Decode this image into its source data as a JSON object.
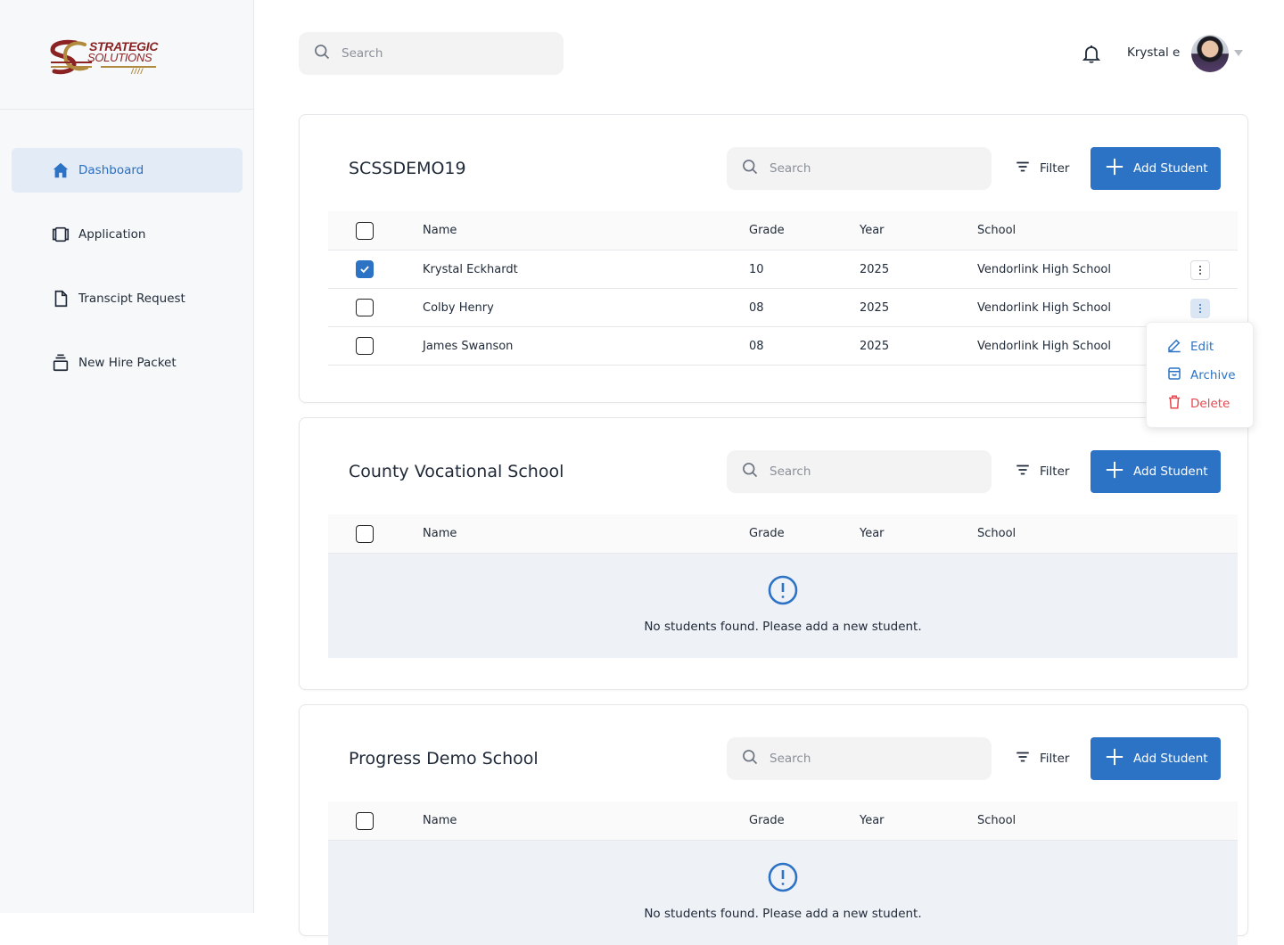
{
  "brand": {
    "line1": "STRATEGIC",
    "line2": "SOLUTIONS"
  },
  "sidebar": {
    "items": [
      {
        "label": "Dashboard",
        "icon": "home-icon",
        "active": true
      },
      {
        "label": "Application",
        "icon": "application-icon"
      },
      {
        "label": "Transcipt Request",
        "icon": "document-icon"
      },
      {
        "label": "New Hire Packet",
        "icon": "packet-icon"
      }
    ]
  },
  "header": {
    "search_placeholder": "Search",
    "user_name": "Krystal e"
  },
  "colors": {
    "accent": "#2d73c5",
    "danger": "#e5484d",
    "brand": "#8b2323"
  },
  "columns": {
    "name": "Name",
    "grade": "Grade",
    "year": "Year",
    "school": "School"
  },
  "cards": [
    {
      "title": "SCSSDEMO19",
      "search_placeholder": "Search",
      "filter_label": "Filter",
      "add_label": "Add Student",
      "rows": [
        {
          "name": "Krystal Eckhardt",
          "grade": "10",
          "year": "2025",
          "school": "Vendorlink High School",
          "checked": true
        },
        {
          "name": "Colby Henry",
          "grade": "08",
          "year": "2025",
          "school": "Vendorlink High School",
          "checked": false
        },
        {
          "name": "James Swanson",
          "grade": "08",
          "year": "2025",
          "school": "Vendorlink High School",
          "checked": false
        }
      ]
    },
    {
      "title": "County Vocational School",
      "search_placeholder": "Search",
      "filter_label": "Filter",
      "add_label": "Add Student",
      "empty_message": "No students found. Please add a new student."
    },
    {
      "title": "Progress Demo School",
      "search_placeholder": "Search",
      "filter_label": "Filter",
      "add_label": "Add Student",
      "empty_message": "No students found. Please add a new student."
    }
  ],
  "row_menu": {
    "edit": "Edit",
    "archive": "Archive",
    "delete": "Delete"
  }
}
